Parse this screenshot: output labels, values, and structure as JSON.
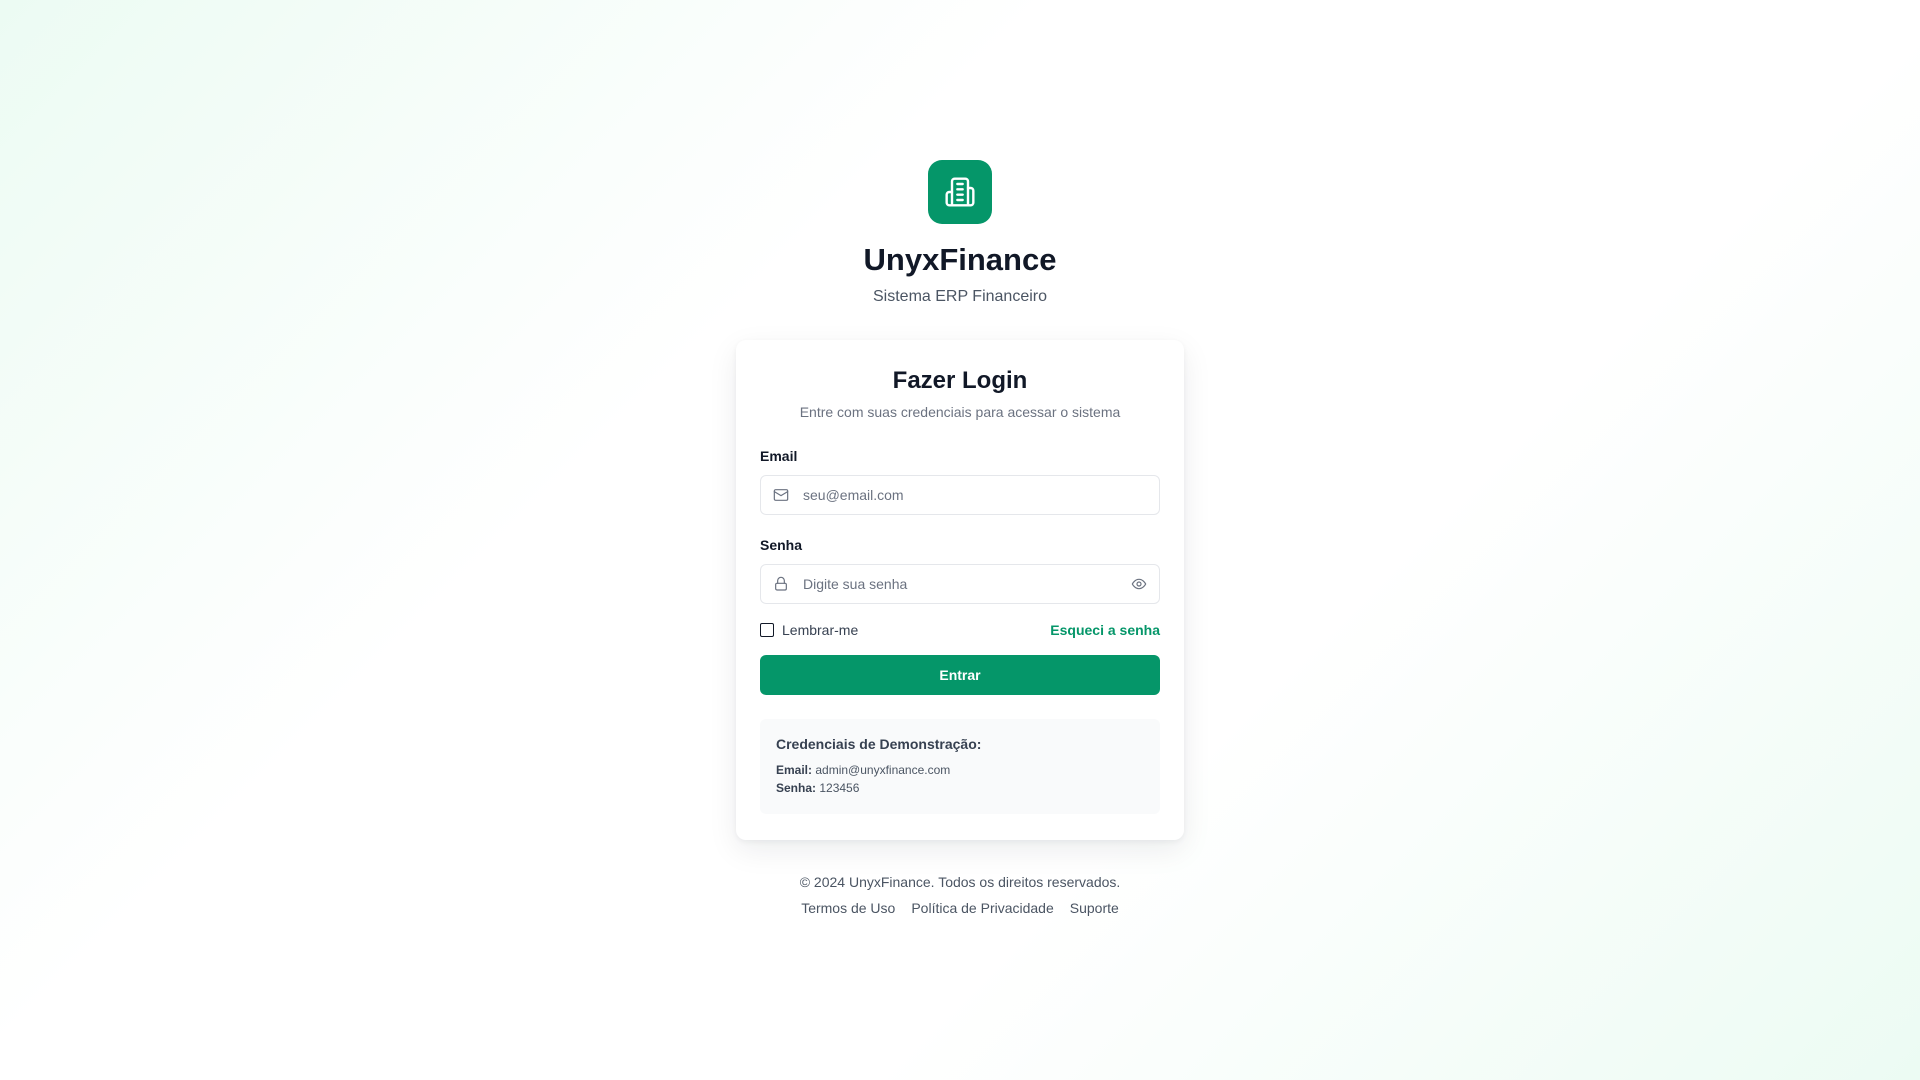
{
  "brand": {
    "name": "UnyxFinance",
    "subtitle": "Sistema ERP Financeiro",
    "logo_icon": "building-icon",
    "accent_color": "#059669"
  },
  "login_card": {
    "title": "Fazer Login",
    "subtitle": "Entre com suas credenciais para acessar o sistema",
    "email": {
      "label": "Email",
      "placeholder": "seu@email.com",
      "value": "",
      "icon": "mail-icon"
    },
    "password": {
      "label": "Senha",
      "placeholder": "Digite sua senha",
      "value": "",
      "icon": "lock-icon",
      "toggle_icon": "eye-icon"
    },
    "remember_label": "Lembrar-me",
    "remember_checked": false,
    "forgot_label": "Esqueci a senha",
    "submit_label": "Entrar"
  },
  "demo": {
    "title": "Credenciais de Demonstração:",
    "email_label": "Email:",
    "email_value": "admin@unyxfinance.com",
    "password_label": "Senha:",
    "password_value": "123456"
  },
  "footer": {
    "copyright": "© 2024 UnyxFinance. Todos os direitos reservados.",
    "links": [
      "Termos de Uso",
      "Política de Privacidade",
      "Suporte"
    ]
  }
}
